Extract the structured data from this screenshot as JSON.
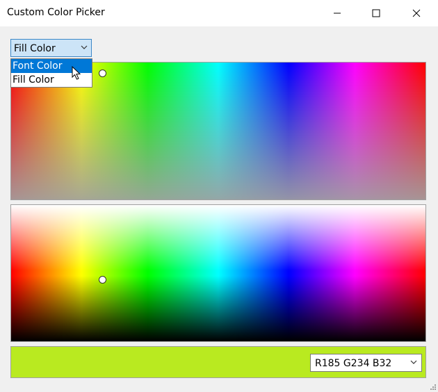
{
  "window": {
    "title": "Custom Color Picker"
  },
  "controls": {
    "target_select": {
      "value": "Fill Color",
      "options": [
        "Font Color",
        "Fill Color"
      ],
      "highlighted": "Font Color"
    },
    "color_value": {
      "text": "R185 G234 B32"
    }
  },
  "colors": {
    "current": "#b9ea20",
    "focus_border": "#3c87c7",
    "selection": "#0078d7"
  },
  "icons": [
    "minimize-icon",
    "maximize-icon",
    "close-icon",
    "chevron-down-icon",
    "mouse-pointer-icon",
    "resize-grip-icon"
  ]
}
